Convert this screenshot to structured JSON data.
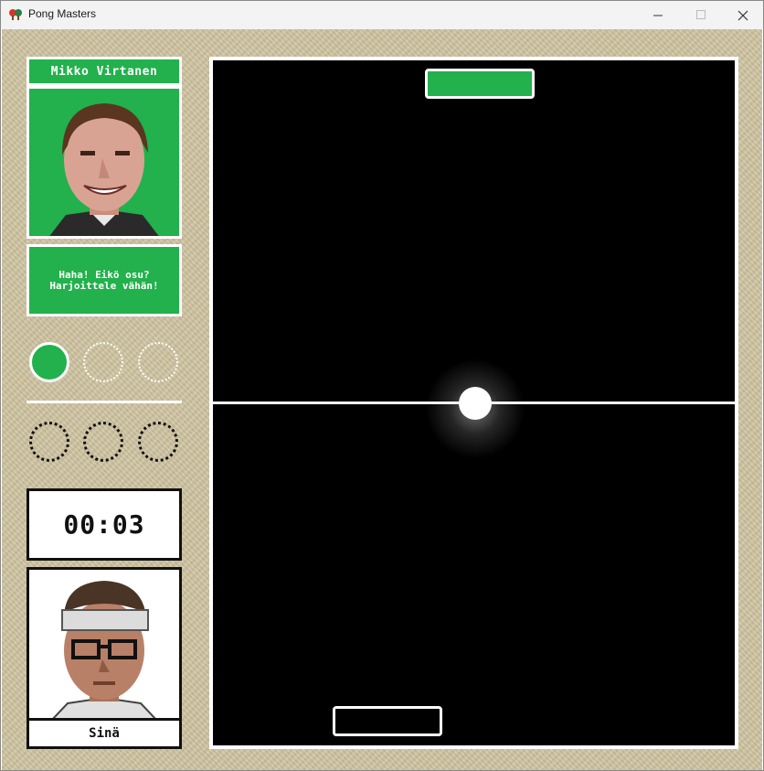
{
  "window": {
    "title": "Pong Masters",
    "controls": [
      "minimize",
      "maximize",
      "close"
    ]
  },
  "opponent": {
    "name": "Mikko Virtanen",
    "taunt": "Haha! Eikö osu? Harjoittele vähän!",
    "points_won": 1,
    "points_total": 3
  },
  "player": {
    "name": "Sinä",
    "points_won": 0,
    "points_total": 3
  },
  "timer": "00:03",
  "colors": {
    "accent_green": "#22b14c",
    "court": "#000000",
    "panel_bg": "#cdc2a0"
  },
  "icons": {
    "app": "ping-pong-paddles-icon",
    "minimize": "minimize-icon",
    "maximize": "maximize-icon",
    "close": "close-icon"
  }
}
